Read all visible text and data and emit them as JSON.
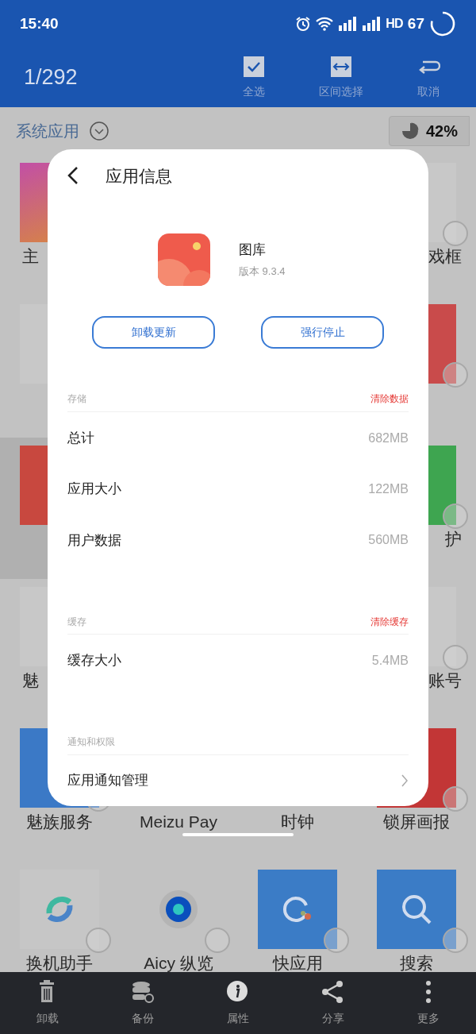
{
  "status_bar": {
    "time": "15:40",
    "network": "HD",
    "battery": "67"
  },
  "toolbar": {
    "count": "1/292",
    "actions": [
      {
        "label": "全选",
        "kind": "select-all"
      },
      {
        "label": "区间选择",
        "kind": "range"
      },
      {
        "label": "取消",
        "kind": "cancel"
      }
    ]
  },
  "category": {
    "title": "系统应用",
    "storage": "42%"
  },
  "apps": [
    {
      "label": "主",
      "cut": true,
      "kind": "gradient",
      "color": "#c24fa6"
    },
    {
      "kind": "covered"
    },
    {
      "kind": "covered"
    },
    {
      "label": "戏框",
      "cut": true,
      "kind": "plain",
      "color": "#c8c8c8",
      "selected": false
    },
    {
      "kind": "plain",
      "color": "#c8c8c8"
    },
    {
      "kind": "covered"
    },
    {
      "kind": "covered"
    },
    {
      "kind": "plain",
      "color": "#c94b4b",
      "selected": false
    },
    {
      "kind": "plain",
      "color": "#c8483f",
      "selected": true
    },
    {
      "kind": "covered"
    },
    {
      "kind": "covered"
    },
    {
      "label": "护",
      "cut": true,
      "kind": "plain",
      "color": "#3ea550",
      "selected": false
    },
    {
      "label": "魅",
      "cut": true,
      "kind": "plain",
      "color": "#c8c8c8"
    },
    {
      "kind": "covered"
    },
    {
      "kind": "covered"
    },
    {
      "label": "账号",
      "cut": true,
      "kind": "plain",
      "color": "#c8c8c8",
      "selected": false
    },
    {
      "label": "魅族服务",
      "kind": "plain",
      "color": "#3b79c6",
      "selected": false
    },
    {
      "label": "Meizu Pay",
      "kind": "covered"
    },
    {
      "label": "时钟",
      "kind": "covered"
    },
    {
      "label": "锁屏画报",
      "kind": "plain",
      "color": "#c23636",
      "selected": false
    },
    {
      "label": "换机助手",
      "kind": "sync",
      "color": "#c6c6c6",
      "selected": false
    },
    {
      "label": "Aicy 纵览",
      "kind": "dot",
      "color": "#c2c2c2",
      "selected": false
    },
    {
      "label": "快应用",
      "kind": "quick",
      "color": "#3b7cc6",
      "selected": false
    },
    {
      "label": "搜索",
      "kind": "search",
      "color": "#3b7cc6",
      "selected": false
    }
  ],
  "dialog": {
    "title": "应用信息",
    "app_name": "图库",
    "version": "版本 9.3.4",
    "buttons": [
      "卸载更新",
      "强行停止"
    ],
    "sections": [
      {
        "header": "存储",
        "action": "清除数据",
        "rows": [
          {
            "label": "总计",
            "value": "682MB"
          },
          {
            "label": "应用大小",
            "value": "122MB"
          },
          {
            "label": "用户数据",
            "value": "560MB"
          }
        ]
      },
      {
        "header": "缓存",
        "action": "清除缓存",
        "rows": [
          {
            "label": "缓存大小",
            "value": "5.4MB"
          }
        ]
      },
      {
        "header": "通知和权限",
        "rows": [
          {
            "label": "应用通知管理",
            "kind": "link"
          }
        ]
      }
    ]
  },
  "bottom_nav": [
    {
      "label": "卸载",
      "kind": "trash"
    },
    {
      "label": "备份",
      "kind": "backup"
    },
    {
      "label": "属性",
      "kind": "info"
    },
    {
      "label": "分享",
      "kind": "share"
    },
    {
      "label": "更多",
      "kind": "more"
    }
  ]
}
